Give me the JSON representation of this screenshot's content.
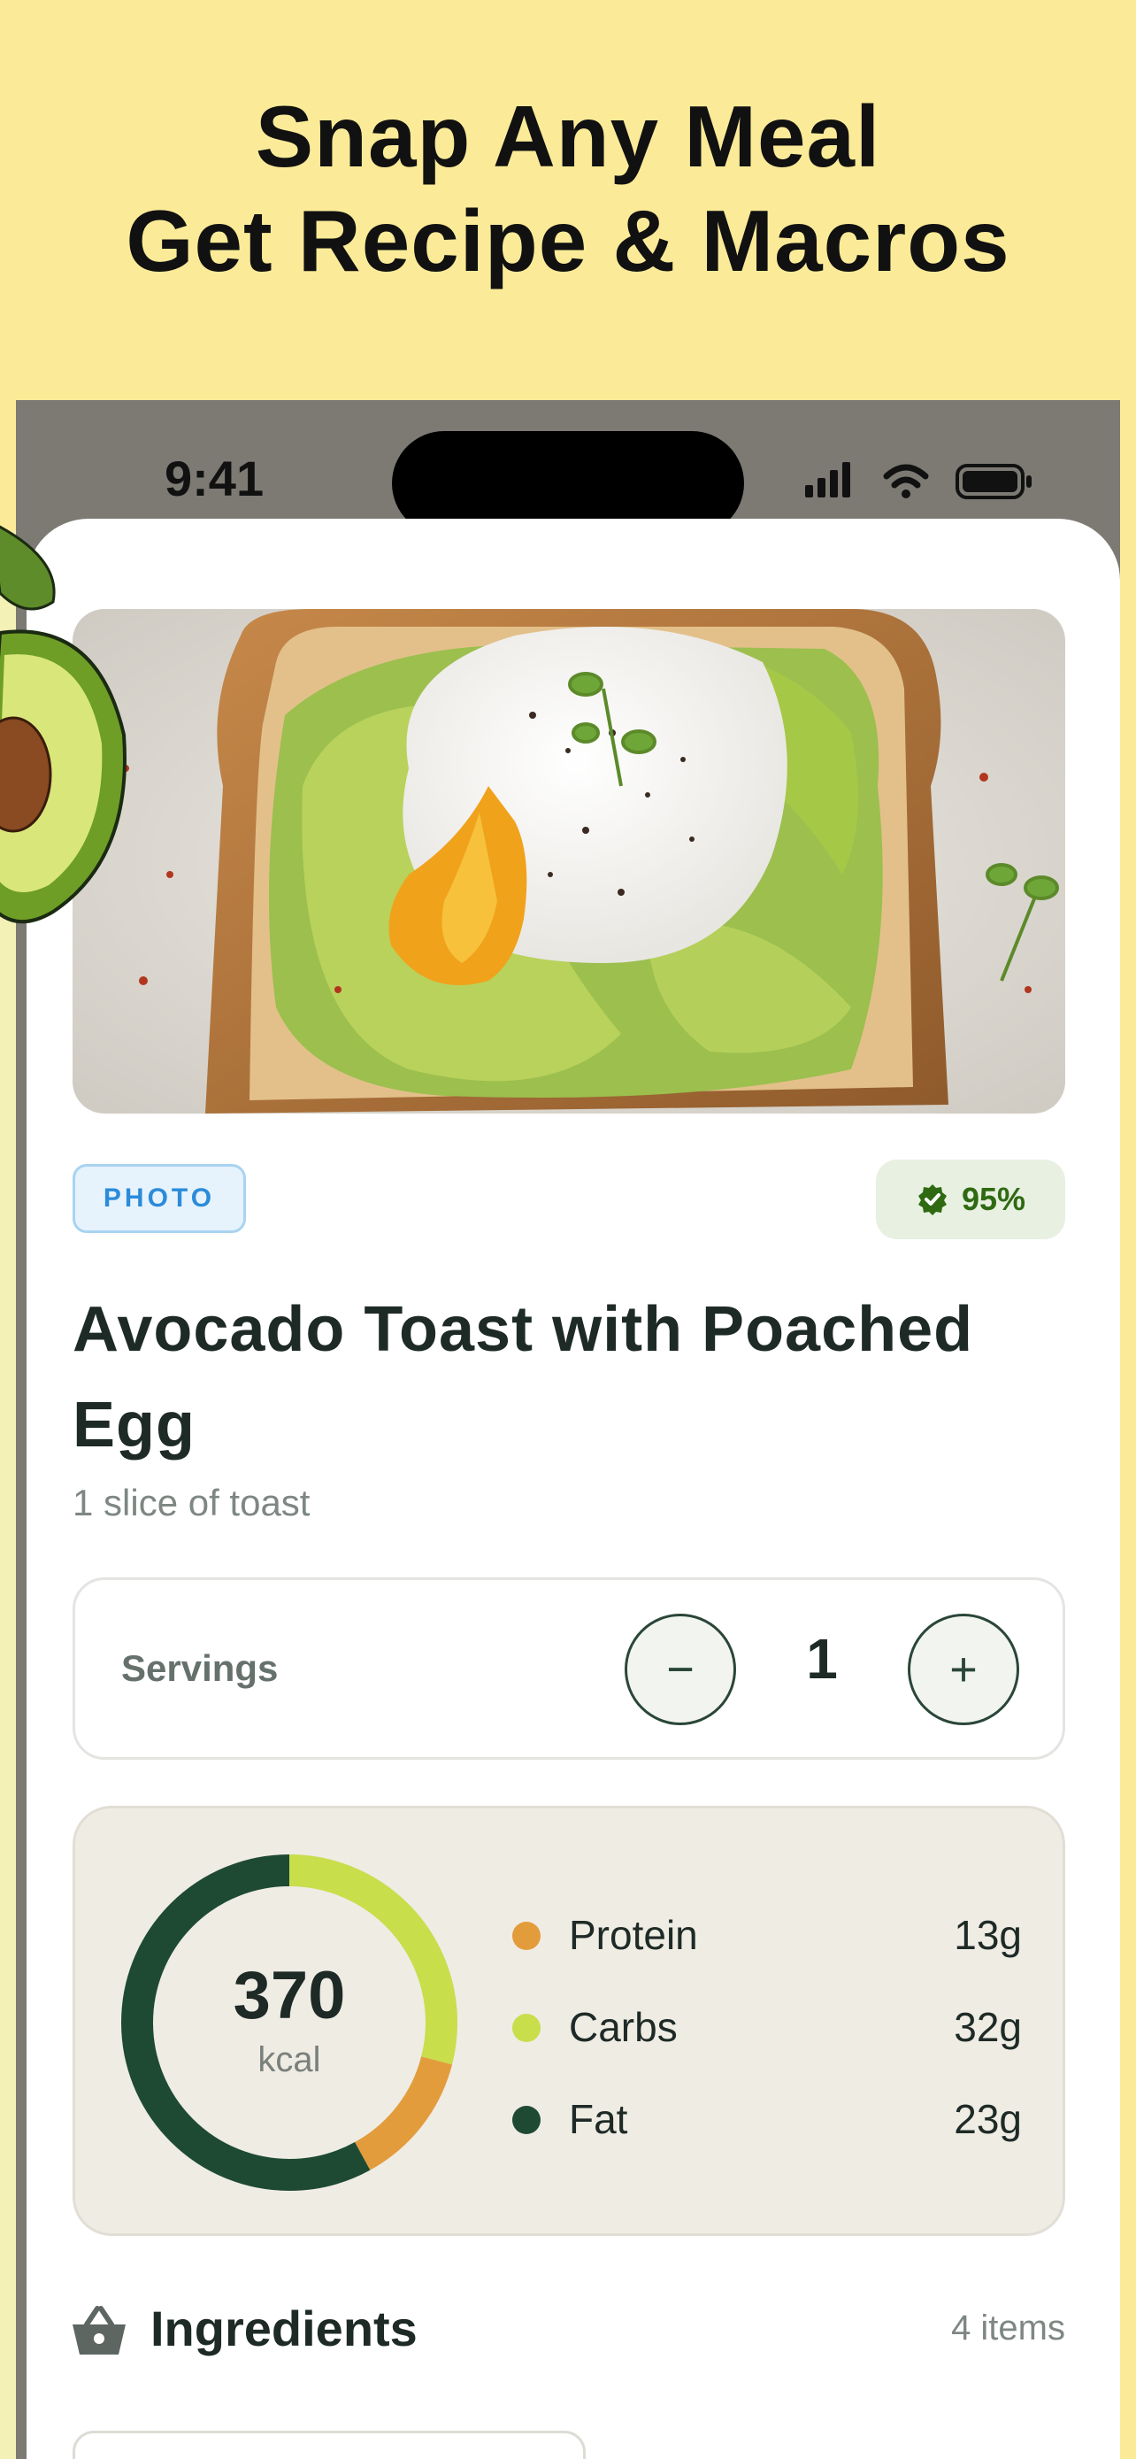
{
  "promo": {
    "headline_line1": "Snap Any Meal",
    "headline_line2": "Get Recipe & Macros"
  },
  "status_bar": {
    "time": "9:41",
    "icons": [
      "cellular-signal-icon",
      "wifi-icon",
      "battery-icon"
    ]
  },
  "meal": {
    "source_badge": "PHOTO",
    "confidence": "95%",
    "title": "Avocado Toast with Poached Egg",
    "portion": "1 slice of toast"
  },
  "servings": {
    "label": "Servings",
    "value": "1",
    "minus_symbol": "−",
    "plus_symbol": "+"
  },
  "nutrition": {
    "calories": "370",
    "calories_unit": "kcal",
    "macros": [
      {
        "name": "Protein",
        "value": "13g",
        "color": "#E39C3C"
      },
      {
        "name": "Carbs",
        "value": "32g",
        "color": "#C8DE4B"
      },
      {
        "name": "Fat",
        "value": "23g",
        "color": "#1E4A33"
      }
    ],
    "ring_fractions": {
      "carbs": 0.29,
      "protein": 0.13,
      "fat": 0.58
    }
  },
  "ingredients": {
    "title": "Ingredients",
    "count": "4 items"
  },
  "colors": {
    "background": "#FBEB98",
    "accent_dark": "#1E4A33",
    "accent_lime": "#C8DE4B",
    "accent_orange": "#E39C3C"
  }
}
